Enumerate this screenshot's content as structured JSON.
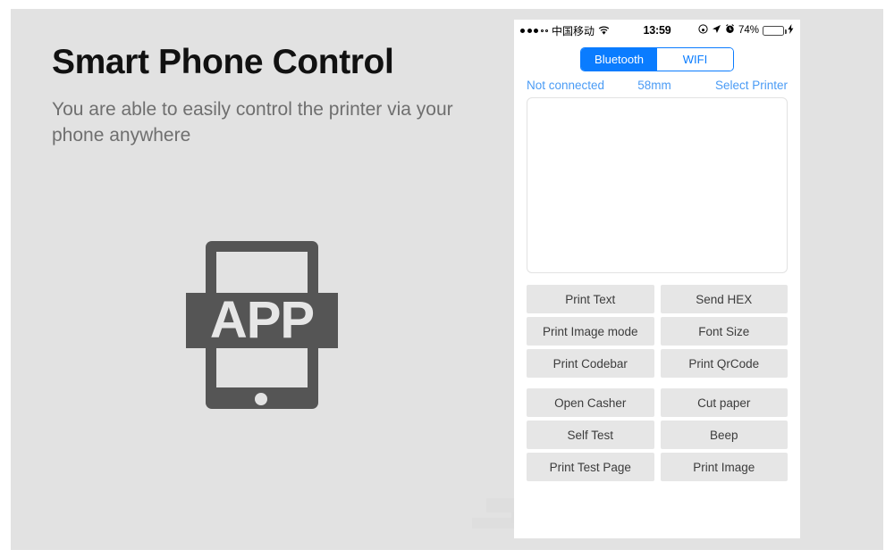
{
  "promo": {
    "title": "Smart Phone Control",
    "subtitle": "You are able to easily control the printer via your phone anywhere",
    "icon_label": "APP",
    "icon_name": "tablet-app-icon"
  },
  "phone": {
    "status_bar": {
      "carrier": "中国移动",
      "signal_dots_filled": 3,
      "signal_dots_empty": 2,
      "wifi_icon": "wifi-icon",
      "time": "13:59",
      "icons": [
        "do-not-disturb-icon",
        "location-arrow-icon",
        "alarm-clock-icon"
      ],
      "battery_percent": "74%",
      "battery_level": 74,
      "charging_icon": "lightning-bolt-icon",
      "battery_color": "#4cd35f"
    },
    "segmented_control": {
      "options": [
        {
          "label": "Bluetooth",
          "selected": true
        },
        {
          "label": "WIFI",
          "selected": false
        }
      ],
      "accent_color": "#0a7cff"
    },
    "info_row": {
      "connection_status": "Not connected",
      "paper_width": "58mm",
      "select_printer": "Select Printer",
      "link_color": "#4a9bf5"
    },
    "text_area": {
      "value": "",
      "placeholder": ""
    },
    "button_groups": [
      {
        "name": "print-actions",
        "buttons": [
          "Print Text",
          "Send HEX",
          "Print Image mode",
          "Font Size",
          "Print Codebar",
          "Print QrCode"
        ]
      },
      {
        "name": "device-actions",
        "buttons": [
          "Open Casher",
          "Cut paper",
          "Self Test",
          "Beep",
          "Print Test Page",
          "Print Image"
        ]
      }
    ]
  },
  "theme": {
    "page_background": "#ffffff",
    "canvas_background": "#e2e2e2",
    "panel_background": "#ffffff",
    "button_background": "#e6e6e6",
    "icon_gray": "#555555"
  }
}
